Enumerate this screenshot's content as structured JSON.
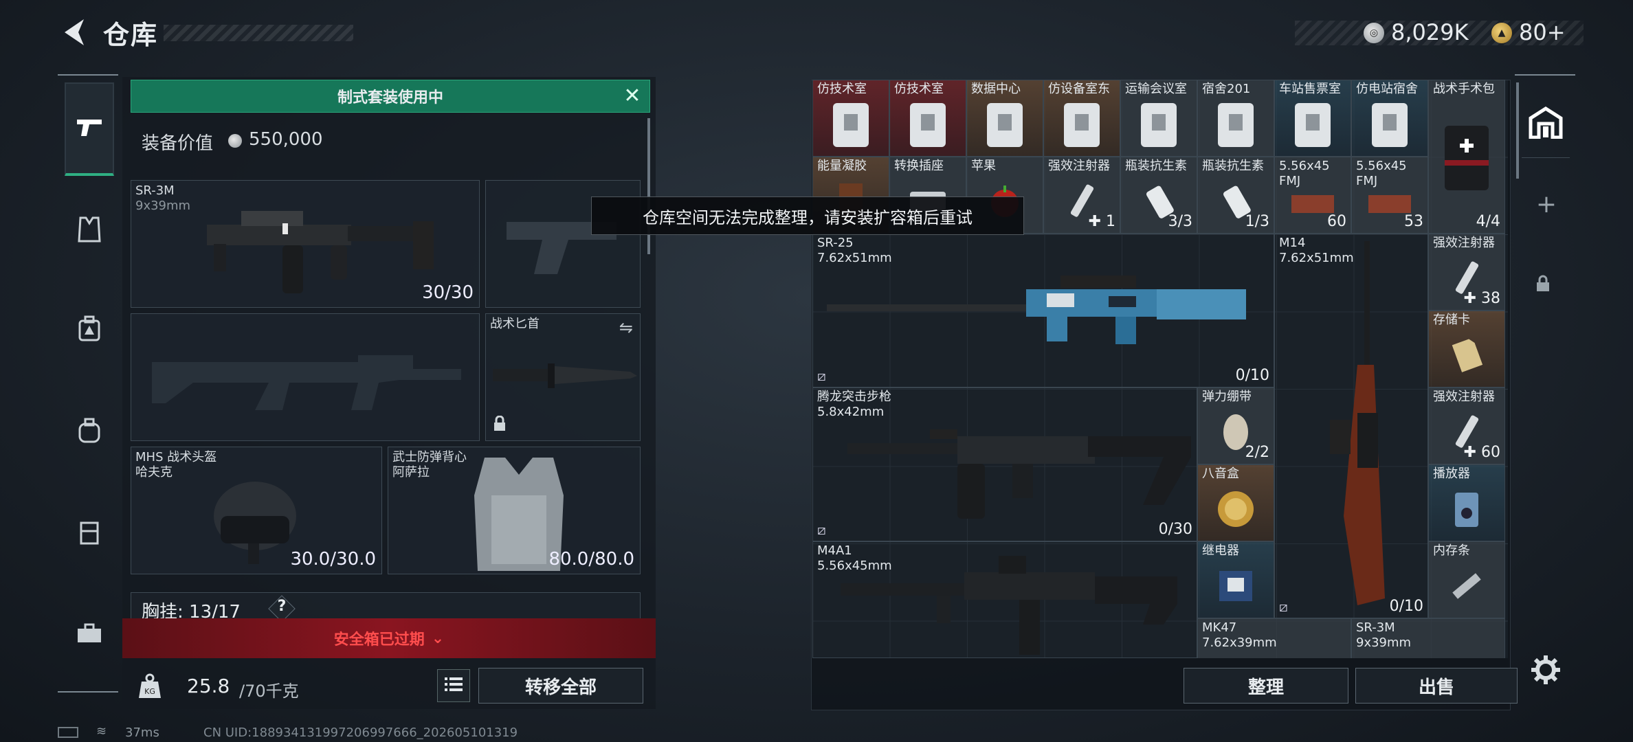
{
  "header": {
    "title": "仓库",
    "silver_amount": "8,029K",
    "gold_amount": "80+"
  },
  "loadout": {
    "banner": "制式套装使用中",
    "equip_value_label": "装备价值",
    "equip_value": "550,000",
    "slots": {
      "primary": {
        "name": "SR-3M",
        "caliber": "9x39mm",
        "count": "30/30"
      },
      "knife": {
        "name": "战术匕首"
      },
      "helmet": {
        "name": "MHS 战术头盔",
        "sub": "哈夫克",
        "durability": "30.0/30.0"
      },
      "armor": {
        "name": "武士防弹背心",
        "sub": "阿萨拉",
        "durability": "80.0/80.0"
      }
    },
    "chest_label": "胸挂: 13/17",
    "help_mark": "?",
    "safe_box_banner": "安全箱已过期",
    "weight_value": "25.8",
    "weight_max": "/70千克",
    "transfer_all": "转移全部"
  },
  "toast": "仓库空间无法完成整理，请安装扩容箱后重试",
  "warehouse": {
    "items": [
      {
        "name": "仿技术室",
        "count": ""
      },
      {
        "name": "仿技术室",
        "count": ""
      },
      {
        "name": "数据中心",
        "count": ""
      },
      {
        "name": "仿设备室东",
        "count": ""
      },
      {
        "name": "运输会议室",
        "count": ""
      },
      {
        "name": "宿舍201",
        "count": ""
      },
      {
        "name": "车站售票室",
        "count": ""
      },
      {
        "name": "仿电站宿舍",
        "count": ""
      },
      {
        "name": "战术手术包",
        "count": "4/4"
      },
      {
        "name": "能量凝胶",
        "count": ""
      },
      {
        "name": "转换插座",
        "count": ""
      },
      {
        "name": "苹果",
        "count": ""
      },
      {
        "name": "强效注射器",
        "count": "✚ 1"
      },
      {
        "name": "瓶装抗生素",
        "count": "3/3"
      },
      {
        "name": "瓶装抗生素",
        "count": "1/3"
      },
      {
        "name": "5.56x45\nFMJ",
        "count": "60"
      },
      {
        "name": "5.56x45\nFMJ",
        "count": "53"
      },
      {
        "name": "SR-25\n7.62x51mm",
        "count": "0/10"
      },
      {
        "name": "M14\n7.62x51mm",
        "count": "0/10"
      },
      {
        "name": "强效注射器",
        "count": "✚ 38"
      },
      {
        "name": "存储卡",
        "count": ""
      },
      {
        "name": "腾龙突击步枪\n5.8x42mm",
        "count": "0/30"
      },
      {
        "name": "弹力绷带",
        "count": "2/2"
      },
      {
        "name": "强效注射器",
        "count": "✚ 60"
      },
      {
        "name": "八音盒",
        "count": ""
      },
      {
        "name": "播放器",
        "count": ""
      },
      {
        "name": "M4A1\n5.56x45mm",
        "count": ""
      },
      {
        "name": "继电器",
        "count": ""
      },
      {
        "name": "内存条",
        "count": ""
      },
      {
        "name": "MK47\n7.62x39mm",
        "count": ""
      },
      {
        "name": "SR-3M\n9x39mm",
        "count": ""
      }
    ]
  },
  "buttons": {
    "sort": "整理",
    "sell": "出售"
  },
  "status": {
    "ping": "37ms",
    "uid": "CN UID:188934131997206997666_202605101319"
  },
  "colors": {
    "banner_green": "#167759",
    "safe_box_red": "#8a1520",
    "warning_text": "#ff4d4d"
  },
  "icons": [
    "back-arrow-icon",
    "pistol-icon",
    "vest-icon",
    "backpack-icon",
    "bag-icon",
    "case-icon",
    "toolbox-icon",
    "warehouse-icon",
    "plus-icon",
    "lock-icon",
    "settings-icon",
    "list-icon",
    "weight-icon",
    "close-icon",
    "swap-icon"
  ]
}
